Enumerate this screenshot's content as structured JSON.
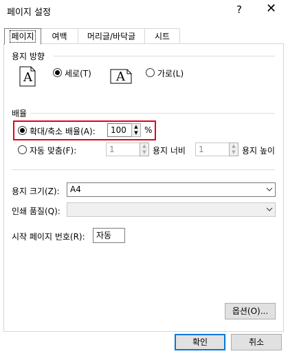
{
  "window": {
    "title": "페이지 설정",
    "help": "?",
    "close": "✕"
  },
  "tabs": [
    {
      "label": "페이지"
    },
    {
      "label": "여백"
    },
    {
      "label": "머리글/바닥글"
    },
    {
      "label": "시트"
    }
  ],
  "orientation": {
    "group_label": "용지 방향",
    "portrait_label": "세로(T)",
    "landscape_label": "가로(L)",
    "portrait_icon_letter": "A",
    "landscape_icon_letter": "A",
    "selected": "portrait"
  },
  "scaling": {
    "group_label": "배율",
    "adjust_label": "확대/축소 배율(A):",
    "adjust_value": "100",
    "percent": "%",
    "fit_label": "자동 맞춤(F):",
    "fit_wide_value": "1",
    "fit_wide_label": "용지 너비",
    "fit_tall_value": "1",
    "fit_tall_label": "용지 높이",
    "selected": "adjust"
  },
  "paper_size": {
    "label": "용지 크기(Z):",
    "value": "A4"
  },
  "print_quality": {
    "label": "인쇄 품질(Q):",
    "value": ""
  },
  "first_page": {
    "label": "시작 페이지 번호(R):",
    "value": "자동"
  },
  "buttons": {
    "options": "옵션(O)...",
    "ok": "확인",
    "cancel": "취소"
  },
  "colors": {
    "highlight": "#e3001b",
    "default_button_border": "#0078d7"
  }
}
